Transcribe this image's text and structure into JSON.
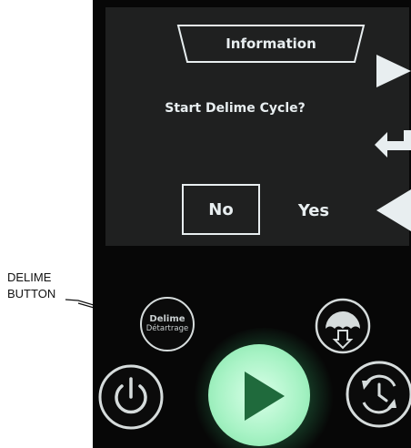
{
  "callout": {
    "line1": "DELIME",
    "line2": "BUTTON"
  },
  "screen": {
    "title": "Information",
    "prompt": "Start Delime Cycle?",
    "no_label": "No",
    "yes_label": "Yes",
    "nav_icons": [
      "triangle-right-icon",
      "enter-return-icon",
      "triangle-left-icon"
    ]
  },
  "controls": {
    "delime_line1": "Delime",
    "delime_line2": "Détartrage",
    "icons": [
      "drain-icon",
      "power-icon",
      "play-icon",
      "timer-cycle-icon"
    ]
  },
  "colors": {
    "screen_text": "#e8eef0",
    "start_button_glow": "#7ee3a6",
    "play_triangle": "#1f6a3c"
  }
}
